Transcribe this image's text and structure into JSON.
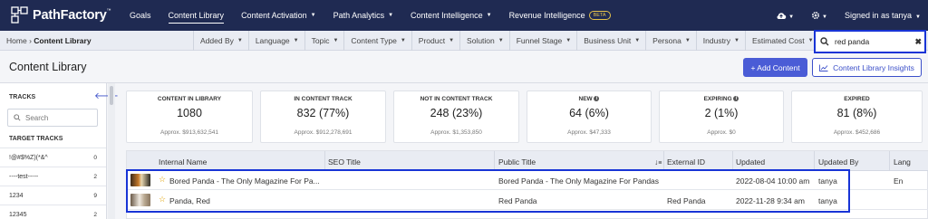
{
  "brand": {
    "name": "PathFactory",
    "tm": "™",
    "nav_bg": "#1f2a52",
    "accent": "#1834d6"
  },
  "nav": {
    "items": [
      {
        "label": "Goals",
        "dropdown": false,
        "active": false
      },
      {
        "label": "Content Library",
        "dropdown": false,
        "active": true
      },
      {
        "label": "Content Activation",
        "dropdown": true,
        "active": false
      },
      {
        "label": "Path Analytics",
        "dropdown": true,
        "active": false
      },
      {
        "label": "Content Intelligence",
        "dropdown": true,
        "active": false
      },
      {
        "label": "Revenue Intelligence",
        "dropdown": false,
        "active": false,
        "badge": "BETA"
      }
    ],
    "cloud_icon": "cloud-upload-icon",
    "gear_icon": "gear-icon",
    "user_label": "Signed in as tanya"
  },
  "breadcrumb": {
    "home": "Home",
    "current": "Content Library",
    "separator": "›"
  },
  "filters": [
    "Added By",
    "Language",
    "Topic",
    "Content Type",
    "Product",
    "Solution",
    "Funnel Stage",
    "Business Unit",
    "Persona",
    "Industry",
    "Estimated Cost"
  ],
  "search": {
    "value": "red panda",
    "clear": "✖"
  },
  "page": {
    "title": "Content Library",
    "add_button": "+ Add Content",
    "insights_button": "Content Library Insights"
  },
  "sidebar": {
    "title": "TRACKS",
    "search_placeholder": "Search",
    "target_title": "TARGET TRACKS",
    "tracks": [
      {
        "name": "!@#$%Z)(*&^",
        "count": "0"
      },
      {
        "name": "----test-----",
        "count": "2"
      },
      {
        "name": "1234",
        "count": "9"
      },
      {
        "name": "12345",
        "count": "2"
      }
    ]
  },
  "stats": [
    {
      "label": "CONTENT IN LIBRARY",
      "value": "1080",
      "approx": "Approx. $913,632,541",
      "info": false
    },
    {
      "label": "IN CONTENT TRACK",
      "value": "832 (77%)",
      "approx": "Approx. $912,278,691",
      "info": false
    },
    {
      "label": "NOT IN CONTENT TRACK",
      "value": "248 (23%)",
      "approx": "Approx. $1,353,850",
      "info": false
    },
    {
      "label": "NEW",
      "value": "64 (6%)",
      "approx": "Approx. $47,333",
      "info": true
    },
    {
      "label": "EXPIRING",
      "value": "2 (1%)",
      "approx": "Approx. $0",
      "info": true
    },
    {
      "label": "EXPIRED",
      "value": "81 (8%)",
      "approx": "Approx. $452,686",
      "info": false
    }
  ],
  "table": {
    "columns": [
      "Internal Name",
      "SEO Title",
      "Public Title",
      "External ID",
      "Updated",
      "Updated By",
      "Lang"
    ],
    "sort_indicator": "↓",
    "rows": [
      {
        "internal_name": "Bored Panda - The Only Magazine For Pa...",
        "seo_title": "",
        "public_title": "Bored Panda - The Only Magazine For Pandas",
        "external_id": "",
        "updated": "2022-08-04 10:00 am",
        "updated_by": "tanya",
        "lang": "En"
      },
      {
        "internal_name": "Panda, Red",
        "seo_title": "",
        "public_title": "Red Panda",
        "external_id": "Red Panda",
        "updated": "2022-11-28 9:34 am",
        "updated_by": "tanya",
        "lang": ""
      }
    ]
  }
}
